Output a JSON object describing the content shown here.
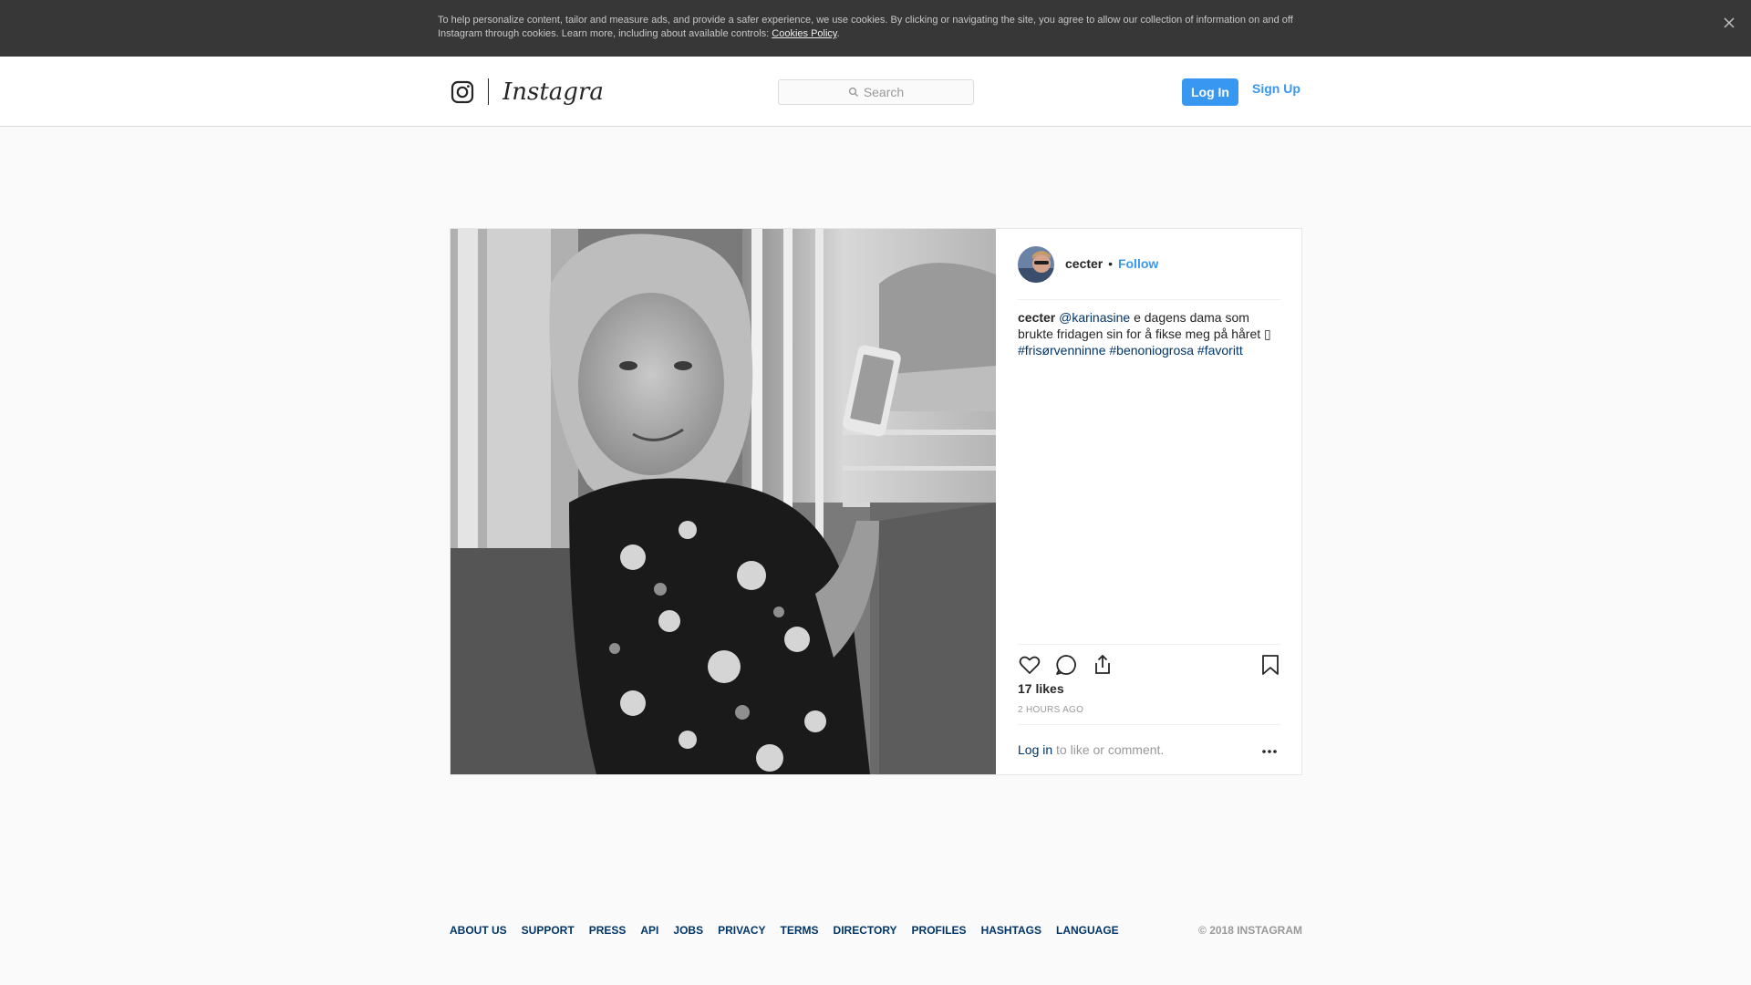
{
  "cookie_banner": {
    "text": "To help personalize content, tailor and measure ads, and provide a safer experience, we use cookies. By clicking or navigating the site, you agree to allow our collection of information on and off Instagram through cookies. Learn more, including about available controls: ",
    "link_label": "Cookies Policy",
    "link_suffix": ".",
    "close_icon": "close-icon"
  },
  "header": {
    "logo_icon": "instagram-glyph-icon",
    "wordmark": "Instagram",
    "search": {
      "placeholder": "Search",
      "icon": "search-icon"
    },
    "login_label": "Log In",
    "signup_label": "Sign Up"
  },
  "post": {
    "username": "cecter",
    "separator": "•",
    "follow_label": "Follow",
    "caption": {
      "user": "cecter",
      "mention": "@karinasine",
      "text": " e dagens dama som brukte fridagen sin for å fikse meg på håret ",
      "emoji": "▯",
      "hashtags": [
        "#frisørvenninne",
        "#benoniogrosa",
        "#favoritt"
      ]
    },
    "actions": [
      "heart-icon",
      "comment-icon",
      "share-icon",
      "bookmark-icon"
    ],
    "likes": "17 likes",
    "timestamp": "2 HOURS AGO",
    "comment_prompt": {
      "link": "Log in",
      "text": " to like or comment."
    },
    "more_icon": "more-options-icon"
  },
  "footer": {
    "links": [
      "About Us",
      "Support",
      "Press",
      "API",
      "Jobs",
      "Privacy",
      "Terms",
      "Directory",
      "Profiles",
      "Hashtags",
      "Language"
    ],
    "copyright": "© 2018 Instagram"
  },
  "colors": {
    "accent": "#3897f0",
    "link_dark": "#003569",
    "banner_bg": "#373737",
    "page_bg": "#fafafa"
  }
}
